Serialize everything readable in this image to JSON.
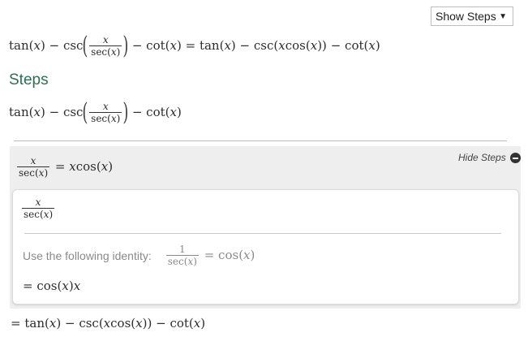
{
  "controls": {
    "show_steps_label": "Show Steps",
    "caret": "▼",
    "hide_steps_label": "Hide Steps"
  },
  "headings": {
    "steps": "Steps"
  },
  "math": {
    "tan": "tan",
    "csc": "csc",
    "cot": "cot",
    "sec": "sec",
    "cos": "cos",
    "x": "x",
    "one": "1",
    "minus": "−",
    "equals": "="
  },
  "identity": {
    "label": "Use the following identity:"
  }
}
